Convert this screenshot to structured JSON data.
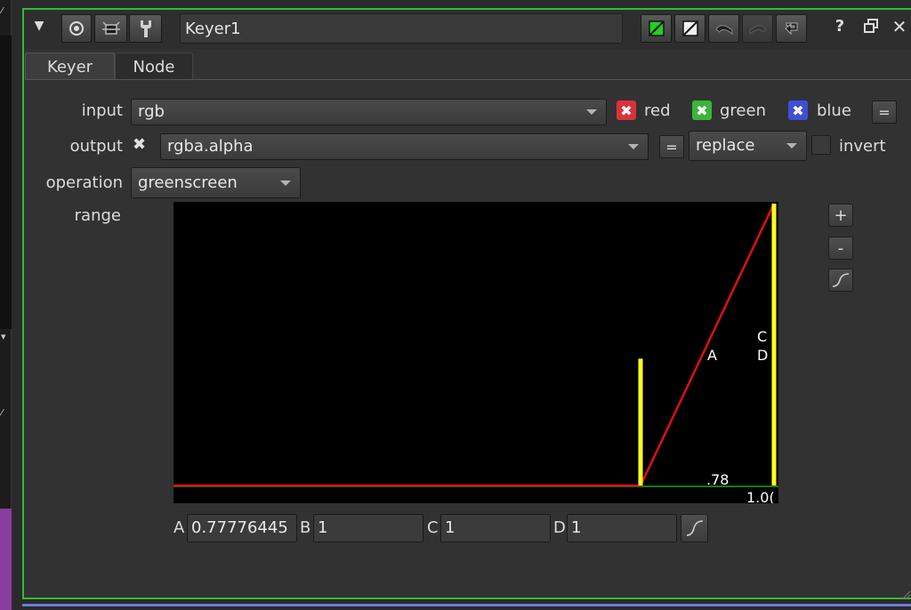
{
  "node": {
    "name": "Keyer1"
  },
  "tabs": [
    {
      "label": "Keyer"
    },
    {
      "label": "Node"
    }
  ],
  "input": {
    "label": "input",
    "value": "rgb",
    "channels": [
      {
        "label": "red",
        "color": "#d9333a",
        "checked": true
      },
      {
        "label": "green",
        "color": "#3ab53a",
        "checked": true
      },
      {
        "label": "blue",
        "color": "#3e4fd6",
        "checked": true
      }
    ],
    "equals": "="
  },
  "output": {
    "label": "output",
    "value": "rgba.alpha",
    "equals": "=",
    "mode": "replace",
    "invert_label": "invert",
    "invert_checked": false
  },
  "operation": {
    "label": "operation",
    "value": "greenscreen"
  },
  "range": {
    "label": "range",
    "graph": {
      "a_marker": "A",
      "c_marker": "C",
      "d_marker": "D",
      "a_readout": ".78",
      "d_readout": "1.0("
    },
    "values": [
      {
        "label": "A",
        "value": "0.77776445"
      },
      {
        "label": "B",
        "value": "1"
      },
      {
        "label": "C",
        "value": "1"
      },
      {
        "label": "D",
        "value": "1"
      }
    ],
    "plus": "+",
    "minus": "-"
  },
  "chart_data": {
    "type": "line",
    "x_range": [
      0,
      1
    ],
    "y_range": [
      0,
      1
    ],
    "A": 0.77776445,
    "B": 1,
    "C": 1,
    "D": 1,
    "curve": [
      [
        0,
        0
      ],
      [
        0.77776445,
        0
      ],
      [
        1,
        1
      ]
    ]
  },
  "colors": {
    "panel_border": "#2fbf2f",
    "curve": "#e01010",
    "markers": "#ffff20",
    "baseline": "#20a020"
  }
}
